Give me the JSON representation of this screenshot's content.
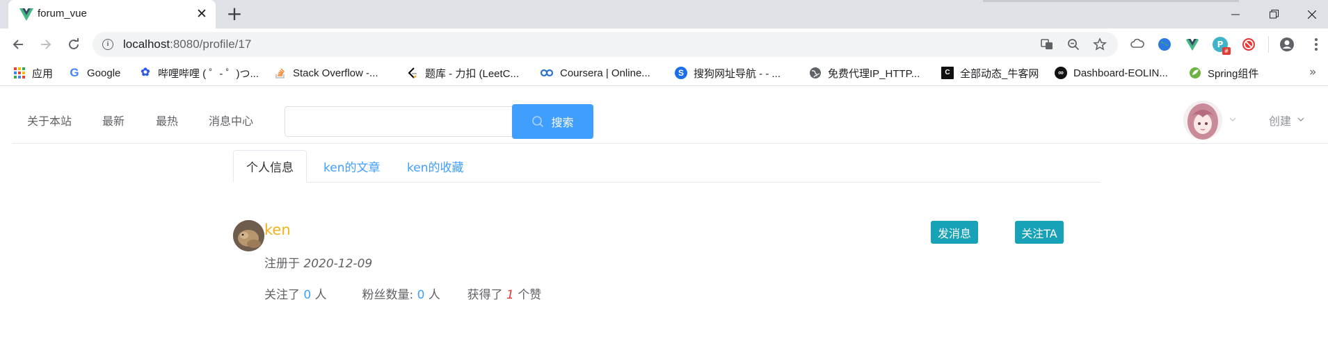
{
  "browser": {
    "tab_title": "forum_vue",
    "url_host": "localhost",
    "url_path": ":8080/profile/17",
    "bookmarks": [
      {
        "label": "应用",
        "icon": "apps-grid-icon"
      },
      {
        "label": "Google",
        "icon": "google-icon"
      },
      {
        "label": "哔哩哔哩 ( ゜- ゜)つ...",
        "icon": "baidu-paw-icon"
      },
      {
        "label": "Stack Overflow -...",
        "icon": "stackoverflow-icon"
      },
      {
        "label": "题库 - 力扣 (LeetC...",
        "icon": "leetcode-icon"
      },
      {
        "label": "Coursera | Online...",
        "icon": "coursera-icon"
      },
      {
        "label": "搜狗网址导航 - - ...",
        "icon": "sogou-icon"
      },
      {
        "label": "免费代理IP_HTTP...",
        "icon": "globe-icon"
      },
      {
        "label": "全部动态_牛客网",
        "icon": "nowcoder-icon"
      },
      {
        "label": "Dashboard-EOLIN...",
        "icon": "eolinker-icon"
      },
      {
        "label": "Spring组件",
        "icon": "spring-icon"
      }
    ],
    "more_glyph": "»"
  },
  "header": {
    "nav": [
      "关于本站",
      "最新",
      "最热",
      "消息中心"
    ],
    "search_placeholder": "",
    "search_button": "搜索",
    "create_label": "创建"
  },
  "tabs": [
    {
      "label": "个人信息",
      "active": true
    },
    {
      "label": "ken的文章",
      "active": false
    },
    {
      "label": "ken的收藏",
      "active": false
    }
  ],
  "profile": {
    "username": "ken",
    "registered_prefix": "注册于 ",
    "registered_date": "2020-12-09",
    "message_button": "发消息",
    "follow_button": "关注TA",
    "following_prefix": "关注了 ",
    "following_count": "0",
    "following_suffix": " 人",
    "fans_prefix": "粉丝数量: ",
    "fans_count": "0",
    "fans_suffix": " 人",
    "likes_prefix": "获得了 ",
    "likes_count": "1",
    "likes_suffix": " 个赞"
  },
  "colors": {
    "primary": "#409eff",
    "teal": "#17a2b8",
    "username": "#f0b31a",
    "likes": "#e3342f"
  }
}
